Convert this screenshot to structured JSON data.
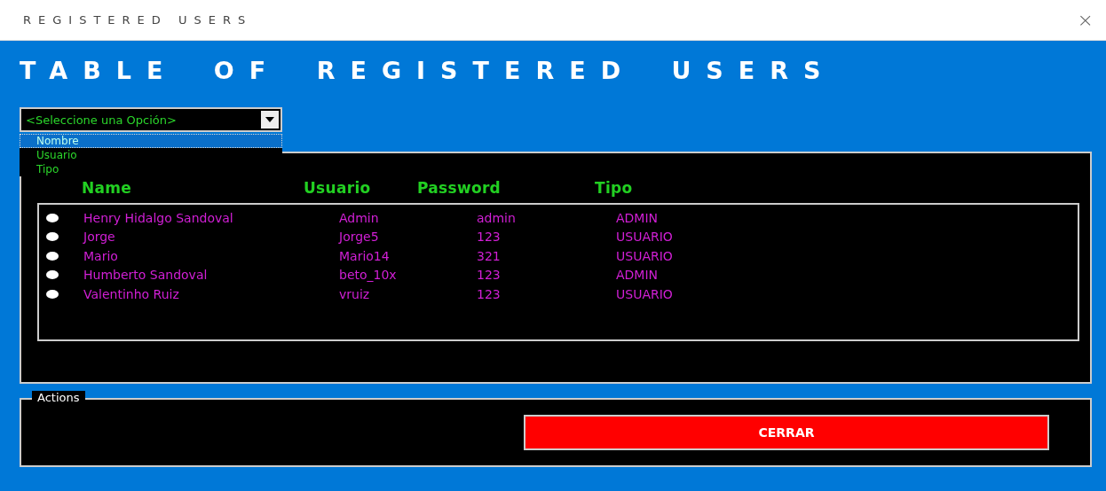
{
  "window": {
    "title": "REGISTERED USERS",
    "close": "×"
  },
  "heading": "TABLE OF REGISTERED USERS",
  "combo": {
    "value": "<Seleccione una Opción>",
    "expanded": true,
    "options": [
      {
        "label": "Nombre",
        "selected": true
      },
      {
        "label": "Usuario",
        "selected": false
      },
      {
        "label": "Tipo",
        "selected": false
      }
    ]
  },
  "table": {
    "columns": [
      "Name",
      "Usuario",
      "Password",
      "Tipo"
    ],
    "rows": [
      {
        "cells": [
          "Henry Hidalgo Sandoval",
          "Admin",
          "admin",
          "ADMIN"
        ],
        "selected": false
      },
      {
        "cells": [
          "Jorge",
          "Jorge5",
          "123",
          "USUARIO"
        ],
        "selected": false
      },
      {
        "cells": [
          "Mario",
          "Mario14",
          "321",
          "USUARIO"
        ],
        "selected": false
      },
      {
        "cells": [
          "Humberto Sandoval",
          "beto_10x",
          "123",
          "ADMIN"
        ],
        "selected": false
      },
      {
        "cells": [
          "Valentinho Ruiz",
          "vruiz",
          "123",
          "USUARIO"
        ],
        "selected": false
      }
    ]
  },
  "actions": {
    "legend": "Actions",
    "buttons": [
      "CERRAR"
    ]
  }
}
